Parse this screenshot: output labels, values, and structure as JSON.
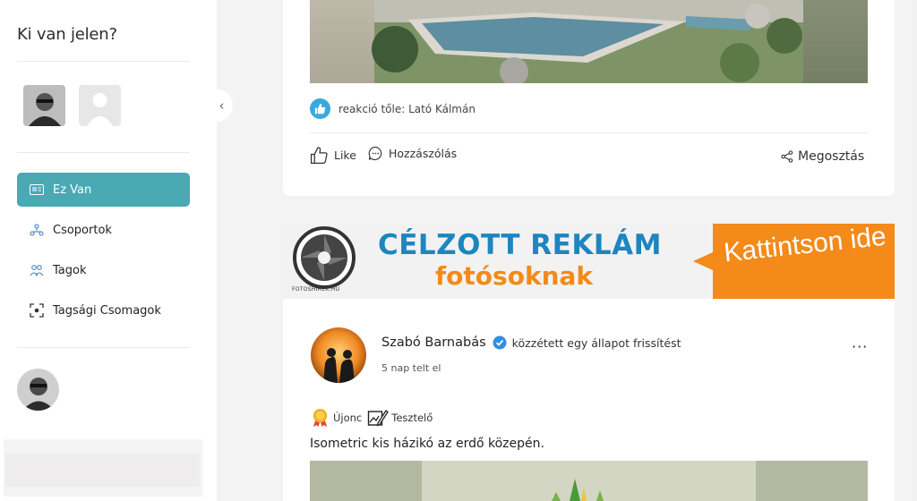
{
  "sidebar": {
    "who_title": "Ki van jelen?",
    "nav": [
      {
        "label": "Ez Van",
        "icon": "id-card-icon",
        "active": true
      },
      {
        "label": "Csoportok",
        "icon": "groups-icon",
        "active": false
      },
      {
        "label": "Tagok",
        "icon": "members-icon",
        "active": false
      },
      {
        "label": "Tagsági Csomagok",
        "icon": "membership-icon",
        "active": false
      }
    ]
  },
  "post1": {
    "reaction_text": "reakció tőle: Lató Kálmán",
    "like_label": "Like",
    "comment_label": "Hozzászólás",
    "share_label": "Megosztás"
  },
  "ad": {
    "logo_text": "FOTOSHIREK.HU",
    "headline": "CÉLZOTT REKLÁM",
    "subline": "fotósoknak",
    "cta": "Kattintson ide"
  },
  "post2": {
    "author": "Szabó Barnabás",
    "action": "közzétett egy állapot frissítést",
    "time": "5 nap telt el",
    "badges": [
      {
        "label": "Újonc",
        "icon": "medal-icon"
      },
      {
        "label": "Tesztelő",
        "icon": "tester-icon"
      }
    ],
    "text": "Isometric kis házikó az erdő közepén.",
    "more": "···"
  },
  "colors": {
    "accent": "#4aa9b2",
    "like_blue": "#39a9df",
    "ad_blue": "#1e85bf",
    "ad_orange": "#f38a19"
  }
}
